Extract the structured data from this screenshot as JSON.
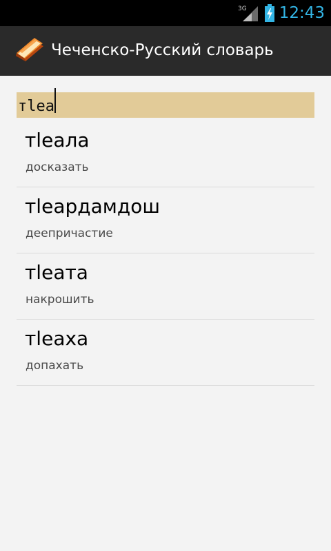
{
  "status_bar": {
    "network_label": "3G",
    "time": "12:43",
    "accent_color": "#33b5e5",
    "icons": [
      "signal-icon",
      "battery-charging-icon"
    ]
  },
  "action_bar": {
    "title": "Чеченско-Русский словарь",
    "icon": "book-icon"
  },
  "search": {
    "value": "тlea",
    "highlight_color": "#e2cb98"
  },
  "results": [
    {
      "word": "тlеала",
      "translation": "досказать"
    },
    {
      "word": "тlеардамдош",
      "translation": "деепричастие"
    },
    {
      "word": "тlеата",
      "translation": "накрошить"
    },
    {
      "word": "тlеаха",
      "translation": "допахать"
    }
  ]
}
